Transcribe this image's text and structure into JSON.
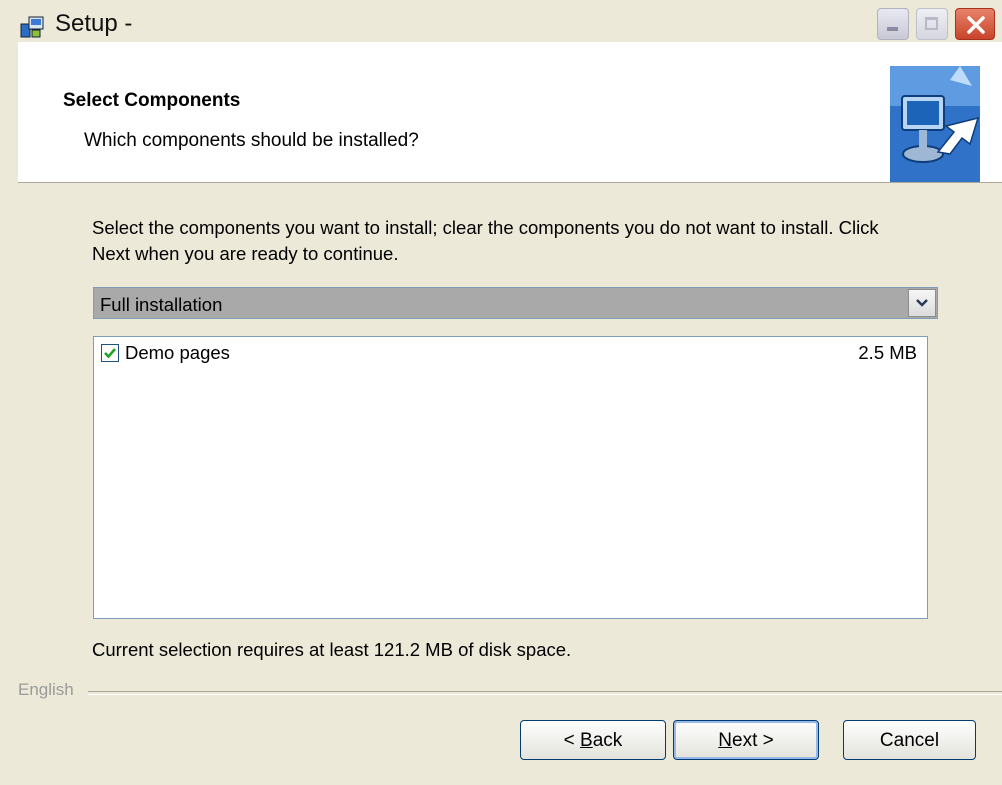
{
  "window": {
    "title": "Setup -",
    "icons": [
      "installer-icon",
      "minimize-icon",
      "maximize-icon",
      "close-icon"
    ]
  },
  "header": {
    "title": "Select Components",
    "subtitle": "Which components should be installed?",
    "image": "computer-arrow-illustration"
  },
  "content": {
    "description": "Select the components you want to install; clear the components you do not want to install. Click Next when you are ready to continue.",
    "install_type": {
      "selected": "Full installation"
    },
    "components": [
      {
        "label": "Demo pages",
        "size": "2.5 MB",
        "checked": true
      }
    ],
    "disk_space": "Current selection requires at least 121.2 MB of disk space."
  },
  "footer": {
    "language": "English",
    "back_label": "< Back",
    "back_mnemonic": "B",
    "next_label": "Next >",
    "next_mnemonic": "N",
    "cancel_label": "Cancel"
  },
  "colors": {
    "window_bg": "#ece9d8",
    "close_button": "#c8442a",
    "checkbox_check": "#21a121",
    "dropdown_selected_bg": "#a9a9a9"
  }
}
